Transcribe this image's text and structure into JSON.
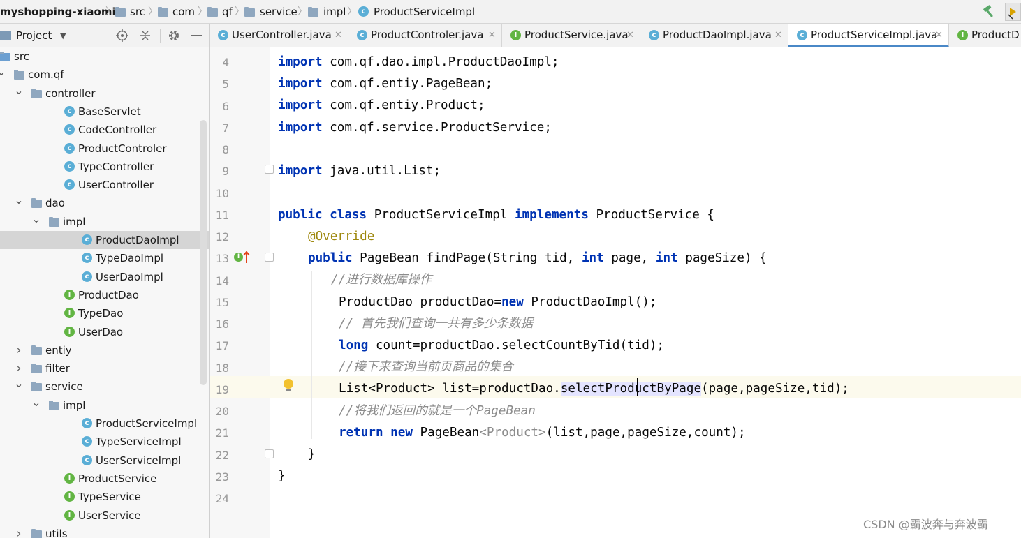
{
  "breadcrumb": {
    "items": [
      "myshopping-xiaomi",
      "src",
      "com",
      "qf",
      "service",
      "impl",
      "ProductServiceImpl"
    ]
  },
  "project_panel": {
    "title": "Project",
    "tree": [
      {
        "label": "src",
        "type": "folder",
        "expanded": true
      },
      {
        "label": "com.qf",
        "type": "package",
        "expanded": true
      },
      {
        "label": "controller",
        "type": "package",
        "expanded": true
      },
      {
        "label": "BaseServlet",
        "type": "class"
      },
      {
        "label": "CodeController",
        "type": "class"
      },
      {
        "label": "ProductControler",
        "type": "class"
      },
      {
        "label": "TypeController",
        "type": "class"
      },
      {
        "label": "UserController",
        "type": "class"
      },
      {
        "label": "dao",
        "type": "package",
        "expanded": true
      },
      {
        "label": "impl",
        "type": "package",
        "expanded": true
      },
      {
        "label": "ProductDaoImpl",
        "type": "class",
        "selected": true
      },
      {
        "label": "TypeDaoImpl",
        "type": "class"
      },
      {
        "label": "UserDaoImpl",
        "type": "class"
      },
      {
        "label": "ProductDao",
        "type": "interface"
      },
      {
        "label": "TypeDao",
        "type": "interface"
      },
      {
        "label": "UserDao",
        "type": "interface"
      },
      {
        "label": "entiy",
        "type": "package",
        "expanded": false
      },
      {
        "label": "filter",
        "type": "package",
        "expanded": false
      },
      {
        "label": "service",
        "type": "package",
        "expanded": true
      },
      {
        "label": "impl",
        "type": "package",
        "expanded": true
      },
      {
        "label": "ProductServiceImpl",
        "type": "class"
      },
      {
        "label": "TypeServiceImpl",
        "type": "class"
      },
      {
        "label": "UserServiceImpl",
        "type": "class"
      },
      {
        "label": "ProductService",
        "type": "interface"
      },
      {
        "label": "TypeService",
        "type": "interface"
      },
      {
        "label": "UserService",
        "type": "interface"
      },
      {
        "label": "utils",
        "type": "package",
        "expanded": false
      }
    ]
  },
  "tabs": [
    {
      "label": "UserController.java",
      "type": "class"
    },
    {
      "label": "ProductControler.java",
      "type": "class"
    },
    {
      "label": "ProductService.java",
      "type": "interface"
    },
    {
      "label": "ProductDaoImpl.java",
      "type": "class"
    },
    {
      "label": "ProductServiceImpl.java",
      "type": "class",
      "active": true
    },
    {
      "label": "ProductD",
      "type": "interface"
    }
  ],
  "editor": {
    "line_numbers": [
      "4",
      "5",
      "6",
      "7",
      "8",
      "9",
      "10",
      "11",
      "12",
      "13",
      "14",
      "15",
      "16",
      "17",
      "18",
      "19",
      "20",
      "21",
      "22",
      "23",
      "24"
    ],
    "lines": {
      "l4_kw": "import",
      "l4_rest": " com.qf.dao.impl.ProductDaoImpl;",
      "l5_kw": "import",
      "l5_rest": " com.qf.entiy.PageBean;",
      "l6_kw": "import",
      "l6_rest": " com.qf.entiy.Product;",
      "l7_kw": "import",
      "l7_rest": " com.qf.service.ProductService;",
      "l9_kw": "import",
      "l9_rest": " java.util.List;",
      "l11_kw1": "public",
      "l11_kw2": "class",
      "l11_name": " ProductServiceImpl ",
      "l11_kw3": "implements",
      "l11_rest": " ProductService {",
      "l12_ann": "@Override",
      "l13_kw1": "public",
      "l13_a": " PageBean findPage(String tid, ",
      "l13_kw2": "int",
      "l13_b": " page, ",
      "l13_kw3": "int",
      "l13_c": " pageSize) {",
      "l14_cm": "//进行数据库操作",
      "l15_a": "ProductDao productDao=",
      "l15_kw": "new",
      "l15_b": " ProductDaoImpl();",
      "l16_cm": "// 首先我们查询一共有多少条数据",
      "l17_kw": "long",
      "l17_rest": " count=productDao.selectCountByTid(tid);",
      "l18_cm": "//接下来查询当前页商品的集合",
      "l19_a": "List<Product> list=productDao.",
      "l19_sel": "selectProductByPage",
      "l19_b": "(page,pageSize,tid);",
      "l20_cm": "//将我们返回的就是一个PageBean",
      "l21_kw1": "return",
      "l21_kw2": "new",
      "l21_a": " PageBean",
      "l21_gen": "<Product>",
      "l21_b": "(list,page,pageSize,count);",
      "l22": "}",
      "l23": "}"
    }
  },
  "watermark": "CSDN @霸波奔与奔波霸",
  "colors": {
    "keyword": "#0033b3",
    "comment": "#8c8c8c",
    "annotation": "#9e880d",
    "selection": "#e4e4ff",
    "caret_row": "#fcfaed"
  }
}
